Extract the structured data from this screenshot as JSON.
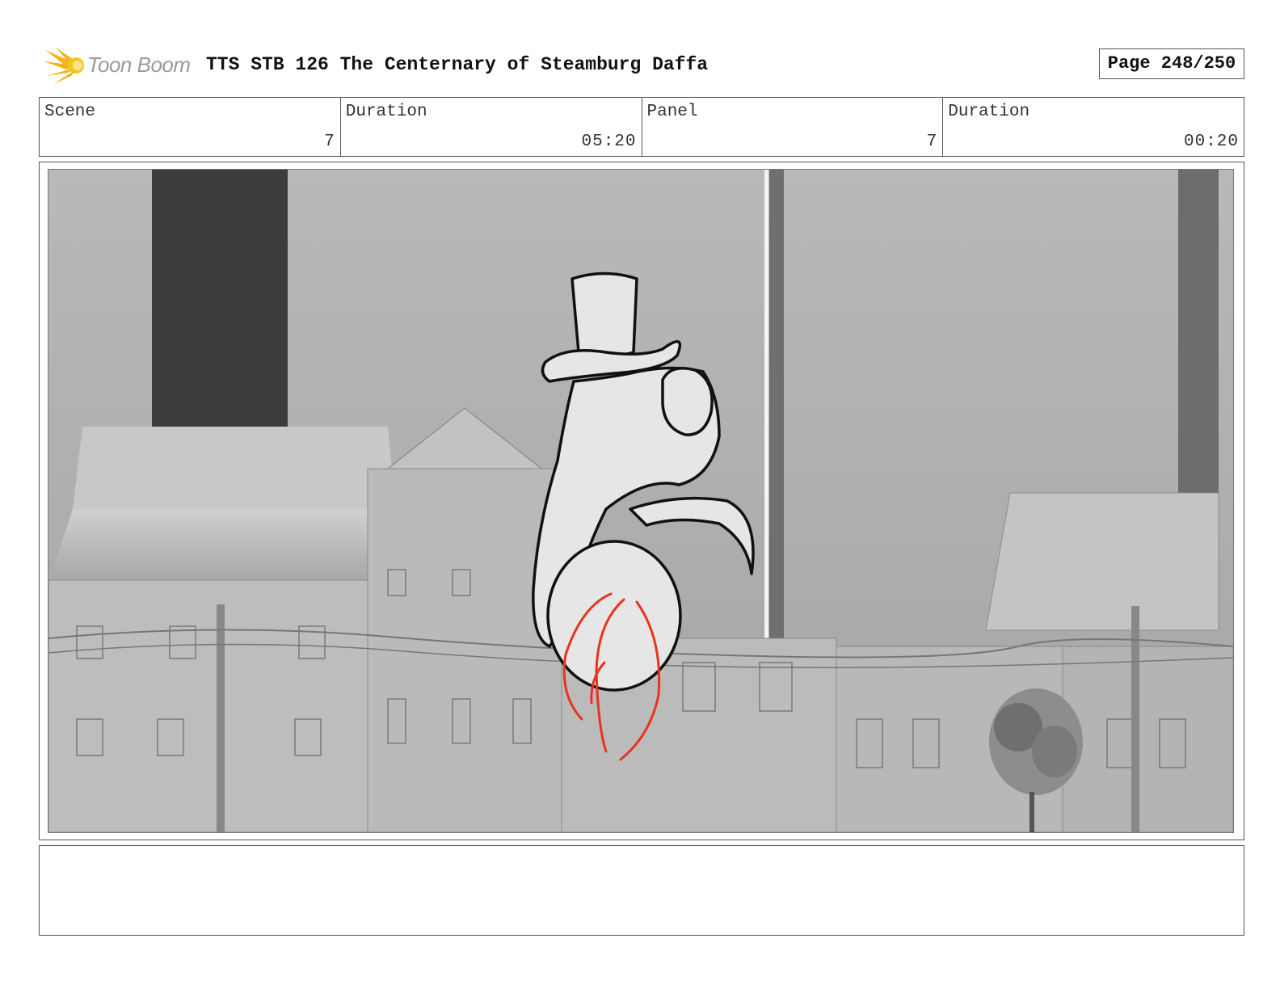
{
  "header": {
    "logo_text": "Toon Boom",
    "title": "TTS STB 126 The Centernary of Steamburg Daffa",
    "page_label": "Page 248/250"
  },
  "info": [
    {
      "label": "Scene",
      "value": "7"
    },
    {
      "label": "Duration",
      "value": "05:20"
    },
    {
      "label": "Panel",
      "value": "7"
    },
    {
      "label": "Duration",
      "value": "00:20"
    }
  ],
  "panel": {
    "description": "",
    "colors": {
      "sky": "#b4b4b4",
      "chimney": "#3c3c3c",
      "building": "#bdbdbd",
      "sketch_line": "#111111",
      "sketch_red": "#e8341c"
    }
  },
  "notes": {
    "text": ""
  }
}
